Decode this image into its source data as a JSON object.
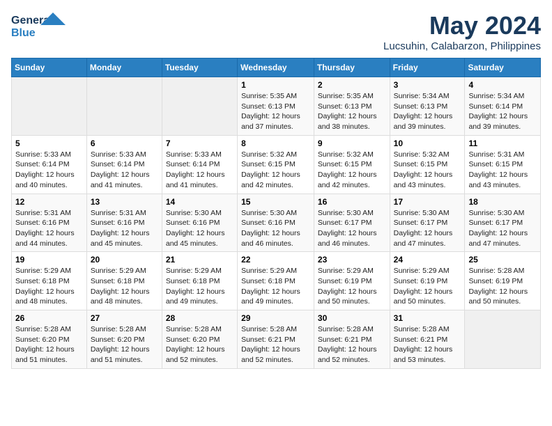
{
  "header": {
    "logo_line1": "General",
    "logo_line2": "Blue",
    "title": "May 2024",
    "subtitle": "Lucsuhin, Calabarzon, Philippines"
  },
  "days_of_week": [
    "Sunday",
    "Monday",
    "Tuesday",
    "Wednesday",
    "Thursday",
    "Friday",
    "Saturday"
  ],
  "weeks": [
    [
      {
        "day": "",
        "info": ""
      },
      {
        "day": "",
        "info": ""
      },
      {
        "day": "",
        "info": ""
      },
      {
        "day": "1",
        "info": "Sunrise: 5:35 AM\nSunset: 6:13 PM\nDaylight: 12 hours and 37 minutes."
      },
      {
        "day": "2",
        "info": "Sunrise: 5:35 AM\nSunset: 6:13 PM\nDaylight: 12 hours and 38 minutes."
      },
      {
        "day": "3",
        "info": "Sunrise: 5:34 AM\nSunset: 6:13 PM\nDaylight: 12 hours and 39 minutes."
      },
      {
        "day": "4",
        "info": "Sunrise: 5:34 AM\nSunset: 6:14 PM\nDaylight: 12 hours and 39 minutes."
      }
    ],
    [
      {
        "day": "5",
        "info": "Sunrise: 5:33 AM\nSunset: 6:14 PM\nDaylight: 12 hours and 40 minutes."
      },
      {
        "day": "6",
        "info": "Sunrise: 5:33 AM\nSunset: 6:14 PM\nDaylight: 12 hours and 41 minutes."
      },
      {
        "day": "7",
        "info": "Sunrise: 5:33 AM\nSunset: 6:14 PM\nDaylight: 12 hours and 41 minutes."
      },
      {
        "day": "8",
        "info": "Sunrise: 5:32 AM\nSunset: 6:15 PM\nDaylight: 12 hours and 42 minutes."
      },
      {
        "day": "9",
        "info": "Sunrise: 5:32 AM\nSunset: 6:15 PM\nDaylight: 12 hours and 42 minutes."
      },
      {
        "day": "10",
        "info": "Sunrise: 5:32 AM\nSunset: 6:15 PM\nDaylight: 12 hours and 43 minutes."
      },
      {
        "day": "11",
        "info": "Sunrise: 5:31 AM\nSunset: 6:15 PM\nDaylight: 12 hours and 43 minutes."
      }
    ],
    [
      {
        "day": "12",
        "info": "Sunrise: 5:31 AM\nSunset: 6:16 PM\nDaylight: 12 hours and 44 minutes."
      },
      {
        "day": "13",
        "info": "Sunrise: 5:31 AM\nSunset: 6:16 PM\nDaylight: 12 hours and 45 minutes."
      },
      {
        "day": "14",
        "info": "Sunrise: 5:30 AM\nSunset: 6:16 PM\nDaylight: 12 hours and 45 minutes."
      },
      {
        "day": "15",
        "info": "Sunrise: 5:30 AM\nSunset: 6:16 PM\nDaylight: 12 hours and 46 minutes."
      },
      {
        "day": "16",
        "info": "Sunrise: 5:30 AM\nSunset: 6:17 PM\nDaylight: 12 hours and 46 minutes."
      },
      {
        "day": "17",
        "info": "Sunrise: 5:30 AM\nSunset: 6:17 PM\nDaylight: 12 hours and 47 minutes."
      },
      {
        "day": "18",
        "info": "Sunrise: 5:30 AM\nSunset: 6:17 PM\nDaylight: 12 hours and 47 minutes."
      }
    ],
    [
      {
        "day": "19",
        "info": "Sunrise: 5:29 AM\nSunset: 6:18 PM\nDaylight: 12 hours and 48 minutes."
      },
      {
        "day": "20",
        "info": "Sunrise: 5:29 AM\nSunset: 6:18 PM\nDaylight: 12 hours and 48 minutes."
      },
      {
        "day": "21",
        "info": "Sunrise: 5:29 AM\nSunset: 6:18 PM\nDaylight: 12 hours and 49 minutes."
      },
      {
        "day": "22",
        "info": "Sunrise: 5:29 AM\nSunset: 6:18 PM\nDaylight: 12 hours and 49 minutes."
      },
      {
        "day": "23",
        "info": "Sunrise: 5:29 AM\nSunset: 6:19 PM\nDaylight: 12 hours and 50 minutes."
      },
      {
        "day": "24",
        "info": "Sunrise: 5:29 AM\nSunset: 6:19 PM\nDaylight: 12 hours and 50 minutes."
      },
      {
        "day": "25",
        "info": "Sunrise: 5:28 AM\nSunset: 6:19 PM\nDaylight: 12 hours and 50 minutes."
      }
    ],
    [
      {
        "day": "26",
        "info": "Sunrise: 5:28 AM\nSunset: 6:20 PM\nDaylight: 12 hours and 51 minutes."
      },
      {
        "day": "27",
        "info": "Sunrise: 5:28 AM\nSunset: 6:20 PM\nDaylight: 12 hours and 51 minutes."
      },
      {
        "day": "28",
        "info": "Sunrise: 5:28 AM\nSunset: 6:20 PM\nDaylight: 12 hours and 52 minutes."
      },
      {
        "day": "29",
        "info": "Sunrise: 5:28 AM\nSunset: 6:21 PM\nDaylight: 12 hours and 52 minutes."
      },
      {
        "day": "30",
        "info": "Sunrise: 5:28 AM\nSunset: 6:21 PM\nDaylight: 12 hours and 52 minutes."
      },
      {
        "day": "31",
        "info": "Sunrise: 5:28 AM\nSunset: 6:21 PM\nDaylight: 12 hours and 53 minutes."
      },
      {
        "day": "",
        "info": ""
      }
    ]
  ]
}
